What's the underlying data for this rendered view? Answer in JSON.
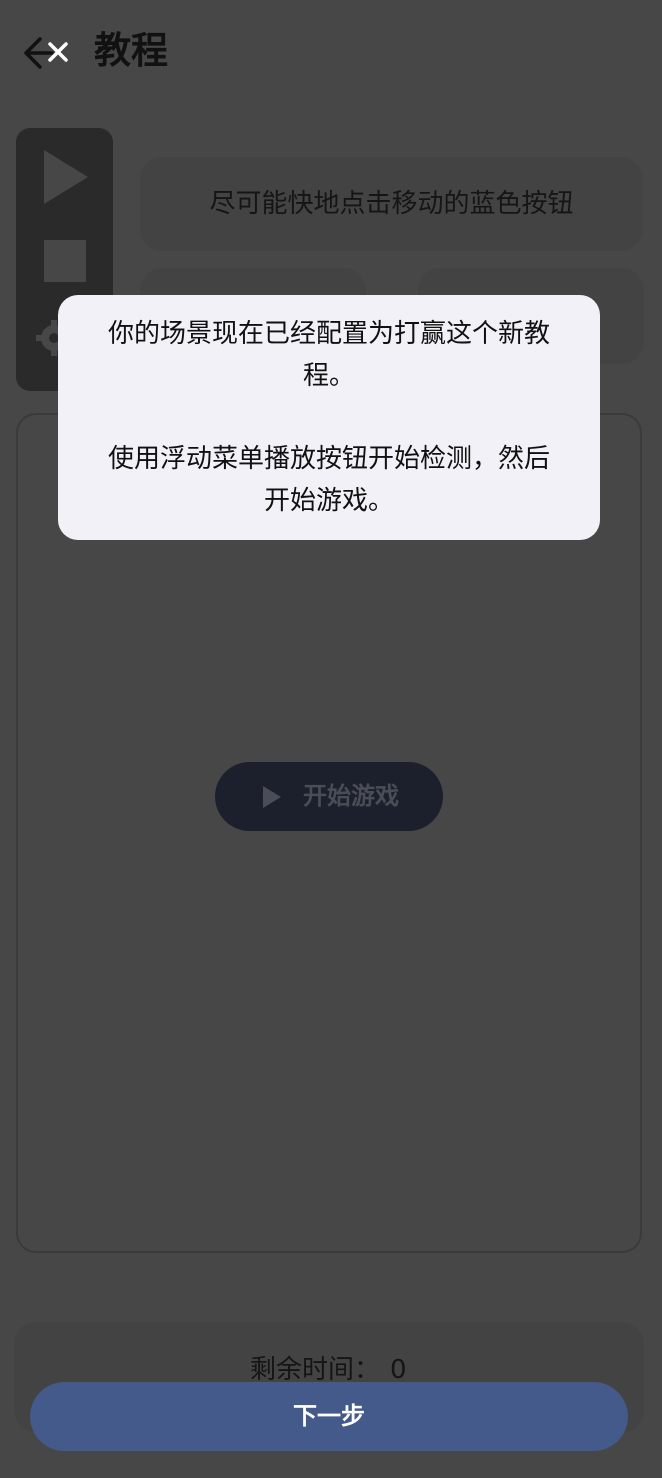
{
  "header": {
    "title": "教程",
    "back_icon": "arrow-left-icon",
    "close_icon": "close-icon"
  },
  "floating_menu": {
    "play_icon": "play-icon",
    "stop_icon": "stop-icon",
    "settings_icon": "gear-icon"
  },
  "instruction": {
    "text": "尽可能快地点击移动的蓝色按钮"
  },
  "game": {
    "start_label": "开始游戏",
    "start_icon": "play-icon"
  },
  "footer": {
    "time_label": "剩余时间：",
    "time_value": "0",
    "next_label": "下一步"
  },
  "tooltip": {
    "line1": "你的场景现在已经配置为打赢这个新教",
    "line2": "程。",
    "line3": "使用浮动菜单播放按钮开始检测，然后",
    "line4": "开始游戏。"
  },
  "colors": {
    "overlay_background": "#474747",
    "tooltip_background": "#f1f1f7",
    "next_button": "#435a8a",
    "start_button": "#1b202c"
  }
}
